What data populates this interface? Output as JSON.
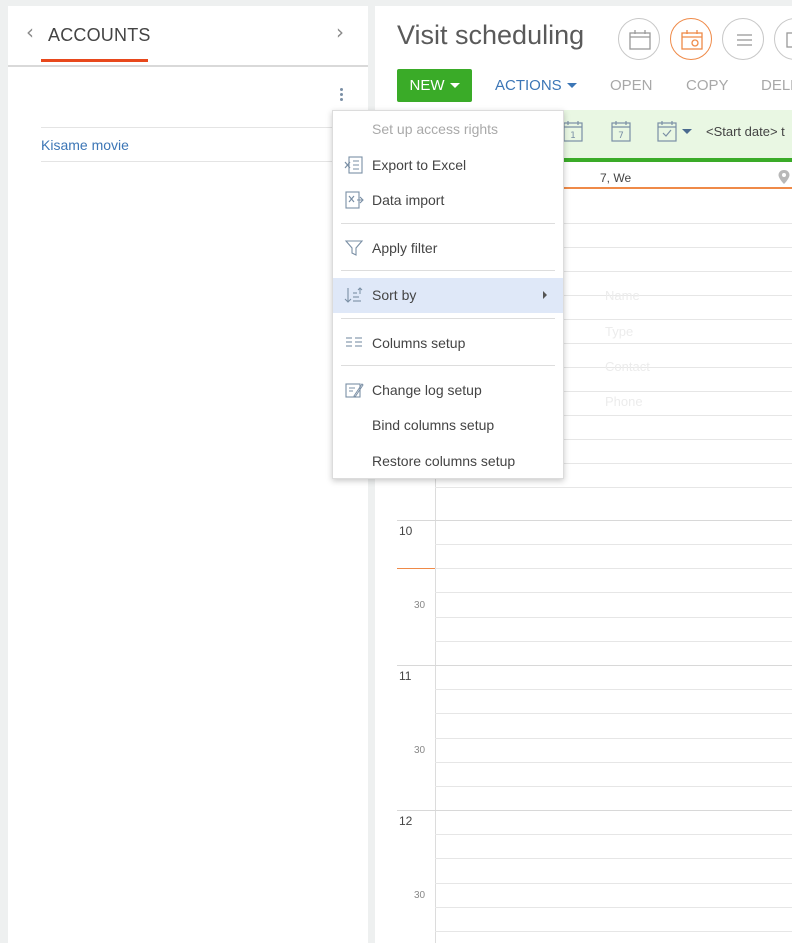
{
  "left": {
    "title": "ACCOUNTS",
    "items": [
      {
        "label": "Kisame movie"
      }
    ]
  },
  "right": {
    "title": "Visit scheduling",
    "view_buttons": [
      {
        "name": "calendar-view-icon",
        "active": false
      },
      {
        "name": "calendar-map-view-icon",
        "active": true
      },
      {
        "name": "list-view-icon",
        "active": false
      }
    ],
    "toolbar": {
      "new_label": "NEW",
      "actions_label": "ACTIONS",
      "open_label": "OPEN",
      "copy_label": "COPY",
      "delete_label": "DELE"
    },
    "date_bar": {
      "icons": [
        "calendar-day-icon",
        "calendar-week-icon",
        "calendar-select-icon"
      ],
      "day_icon_text": "1",
      "week_icon_text": "7",
      "start_date_label": "<Start date> t"
    },
    "day_header": "7, We",
    "hours": [
      {
        "hour": "10",
        "half": "30"
      },
      {
        "hour": "11",
        "half": "30"
      },
      {
        "hour": "12",
        "half": "30"
      }
    ],
    "ghost_fields": [
      "Name",
      "Type",
      "Contact",
      "Phone"
    ]
  },
  "menu": {
    "items": [
      {
        "label": "Set up access rights",
        "icon": "",
        "disabled": true
      },
      {
        "label": "Export to Excel",
        "icon": "excel-export-icon"
      },
      {
        "label": "Data import",
        "icon": "data-import-icon"
      },
      {
        "label": "Apply filter",
        "icon": "filter-icon"
      },
      {
        "label": "Sort by",
        "icon": "sort-icon",
        "active": true,
        "submenu": true
      },
      {
        "label": "Columns setup",
        "icon": "columns-icon"
      },
      {
        "label": "Change log setup",
        "icon": "change-log-icon"
      },
      {
        "label": "Bind columns setup",
        "icon": ""
      },
      {
        "label": "Restore columns setup",
        "icon": ""
      }
    ]
  },
  "colors": {
    "accent_green": "#3aab28",
    "accent_orange": "#ef8a48",
    "link_blue": "#3c76b6",
    "underline_red": "#e8481c"
  }
}
